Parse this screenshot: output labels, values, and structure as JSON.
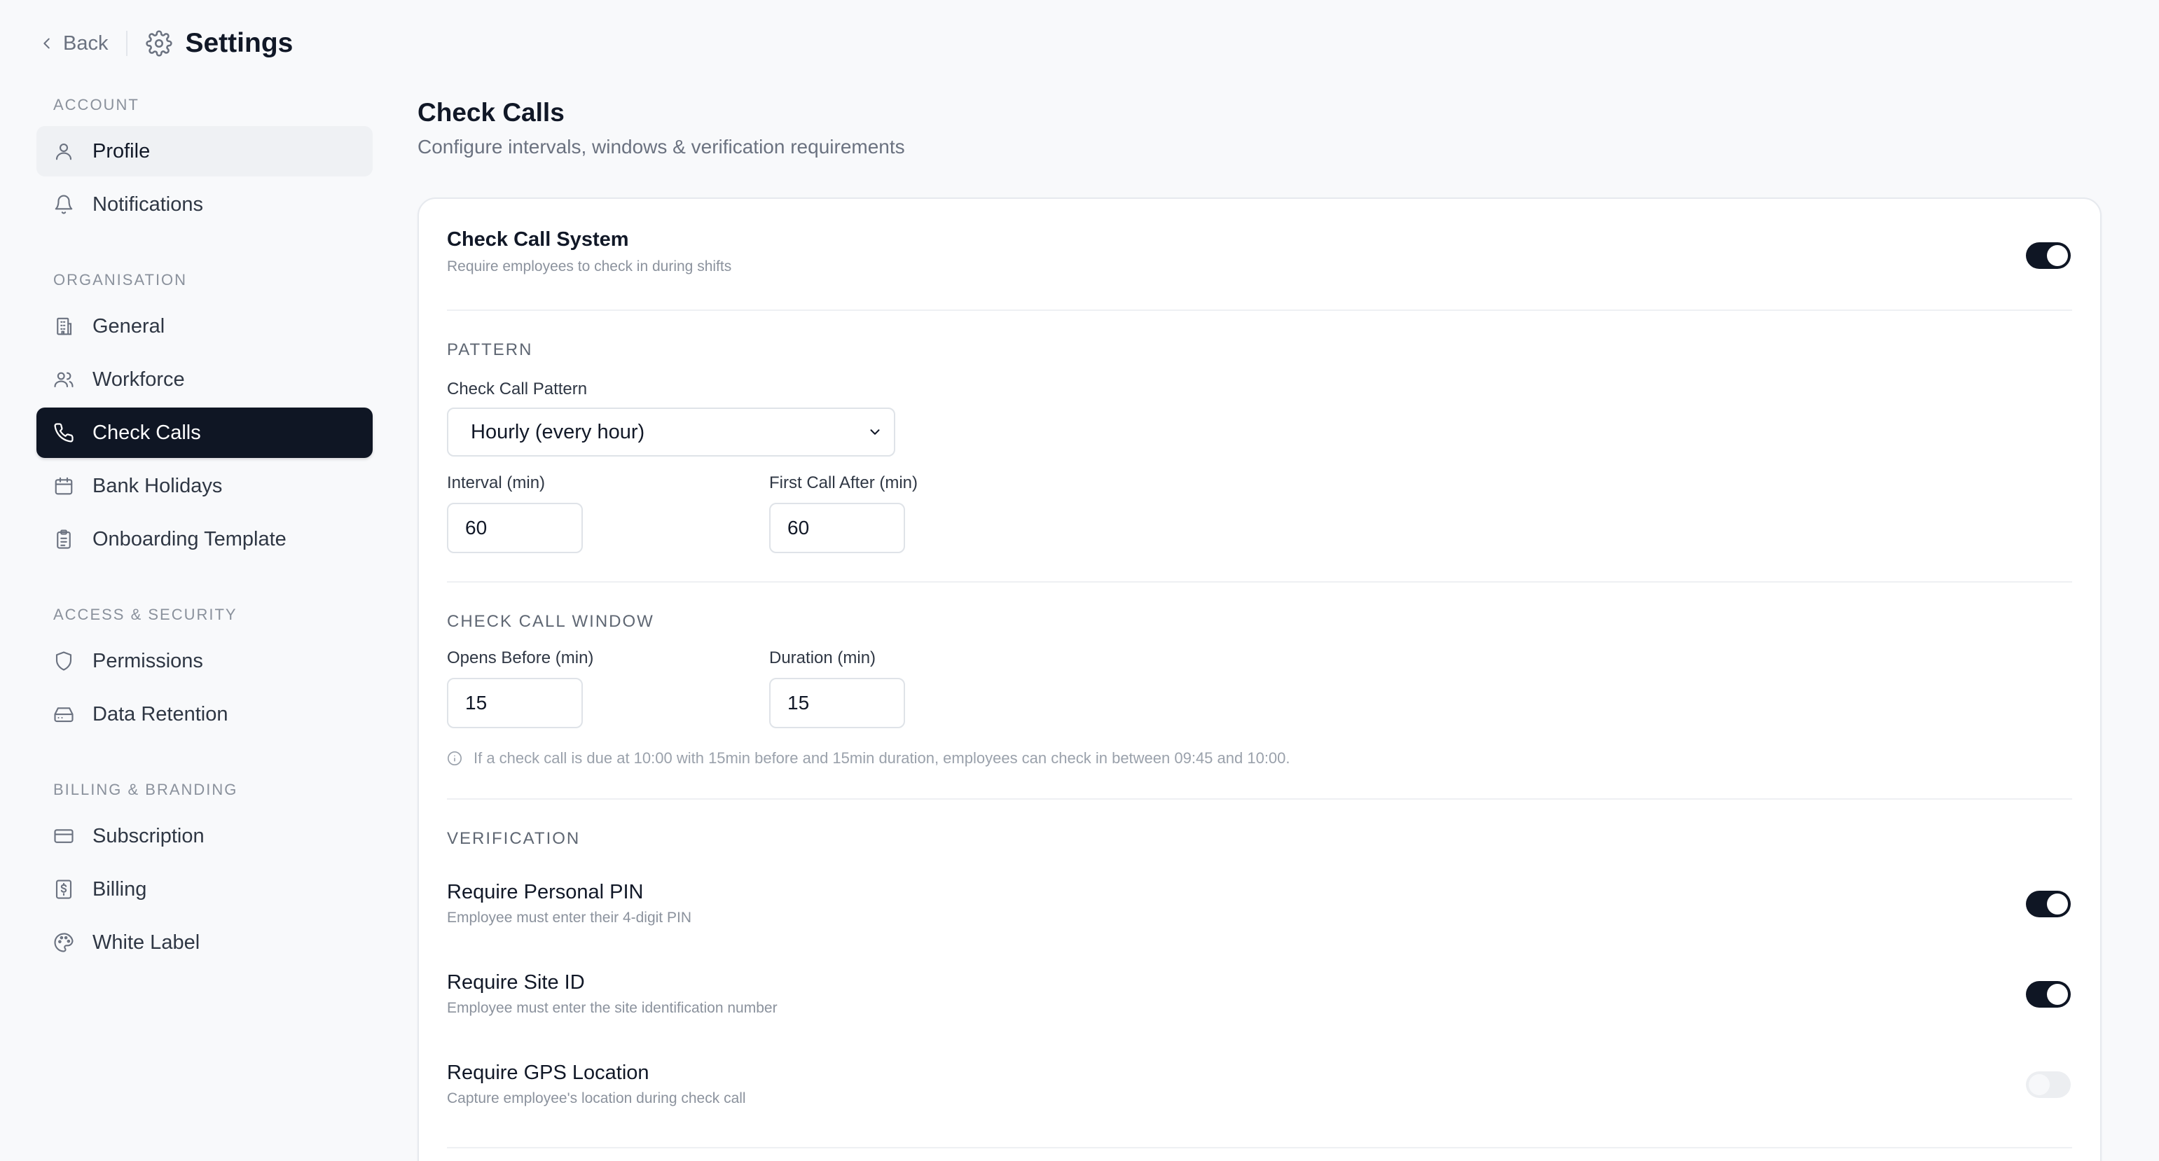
{
  "topbar": {
    "back_label": "Back",
    "title": "Settings"
  },
  "sidebar": {
    "sections": [
      {
        "label": "ACCOUNT",
        "items": [
          {
            "label": "Profile",
            "icon": "user-icon"
          },
          {
            "label": "Notifications",
            "icon": "bell-icon"
          }
        ]
      },
      {
        "label": "ORGANISATION",
        "items": [
          {
            "label": "General",
            "icon": "building-icon"
          },
          {
            "label": "Workforce",
            "icon": "users-icon"
          },
          {
            "label": "Check Calls",
            "icon": "phone-icon"
          },
          {
            "label": "Bank Holidays",
            "icon": "calendar-icon"
          },
          {
            "label": "Onboarding Template",
            "icon": "clipboard-icon"
          }
        ]
      },
      {
        "label": "ACCESS & SECURITY",
        "items": [
          {
            "label": "Permissions",
            "icon": "shield-icon"
          },
          {
            "label": "Data Retention",
            "icon": "hard-drive-icon"
          }
        ]
      },
      {
        "label": "BILLING & BRANDING",
        "items": [
          {
            "label": "Subscription",
            "icon": "credit-card-icon"
          },
          {
            "label": "Billing",
            "icon": "receipt-icon"
          },
          {
            "label": "White Label",
            "icon": "palette-icon"
          }
        ]
      }
    ],
    "active_item": "Check Calls",
    "hovered_item": "Profile"
  },
  "page": {
    "title": "Check Calls",
    "subtitle": "Configure intervals, windows & verification requirements"
  },
  "system": {
    "title": "Check Call System",
    "description": "Require employees to check in during shifts",
    "enabled": true
  },
  "pattern": {
    "section_label": "PATTERN",
    "pattern_label": "Check Call Pattern",
    "pattern_value": "Hourly (every hour)",
    "interval_label": "Interval (min)",
    "interval_value": "60",
    "first_call_label": "First Call After (min)",
    "first_call_value": "60"
  },
  "window": {
    "section_label": "CHECK CALL WINDOW",
    "opens_before_label": "Opens Before (min)",
    "opens_before_value": "15",
    "duration_label": "Duration (min)",
    "duration_value": "15",
    "hint": "If a check call is due at 10:00 with 15min before and 15min duration, employees can check in between 09:45 and 10:00."
  },
  "verification": {
    "section_label": "VERIFICATION",
    "items": [
      {
        "title": "Require Personal PIN",
        "description": "Employee must enter their 4-digit PIN",
        "enabled": true
      },
      {
        "title": "Require Site ID",
        "description": "Employee must enter the site identification number",
        "enabled": true
      },
      {
        "title": "Require GPS Location",
        "description": "Capture employee's location during check call",
        "enabled": false
      }
    ]
  },
  "colors": {
    "background": "#f8f9fb",
    "primary": "#0f1624",
    "card": "#ffffff",
    "muted_text": "#6b7280"
  }
}
